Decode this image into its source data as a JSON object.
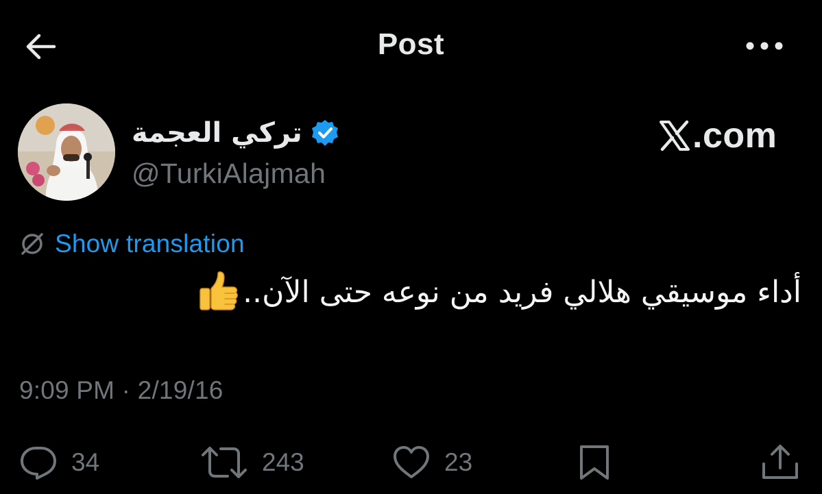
{
  "header": {
    "title": "Post"
  },
  "author": {
    "display_name": "تركي العجمة",
    "handle": "@TurkiAlajmah",
    "verified": true
  },
  "source": {
    "label": "X.com",
    "text": ".com"
  },
  "translation": {
    "label": "Show translation"
  },
  "tweet": {
    "text": "أداء موسيقي هلالي فريد من نوعه حتى الآن..",
    "emoji": "thumbs-up"
  },
  "meta": {
    "timestamp": "9:09 PM · 2/19/16"
  },
  "actions": {
    "replies": "34",
    "retweets": "243",
    "likes": "23"
  },
  "colors": {
    "background": "#000000",
    "primary_text": "#e7e9ea",
    "secondary_text": "#71767b",
    "accent": "#1d9bf0"
  },
  "icons": [
    "back-arrow-icon",
    "more-icon",
    "verified-icon",
    "x-logo-icon",
    "translate-globe-icon",
    "thumbs-up-icon",
    "reply-icon",
    "retweet-icon",
    "like-icon",
    "bookmark-icon",
    "share-icon"
  ]
}
